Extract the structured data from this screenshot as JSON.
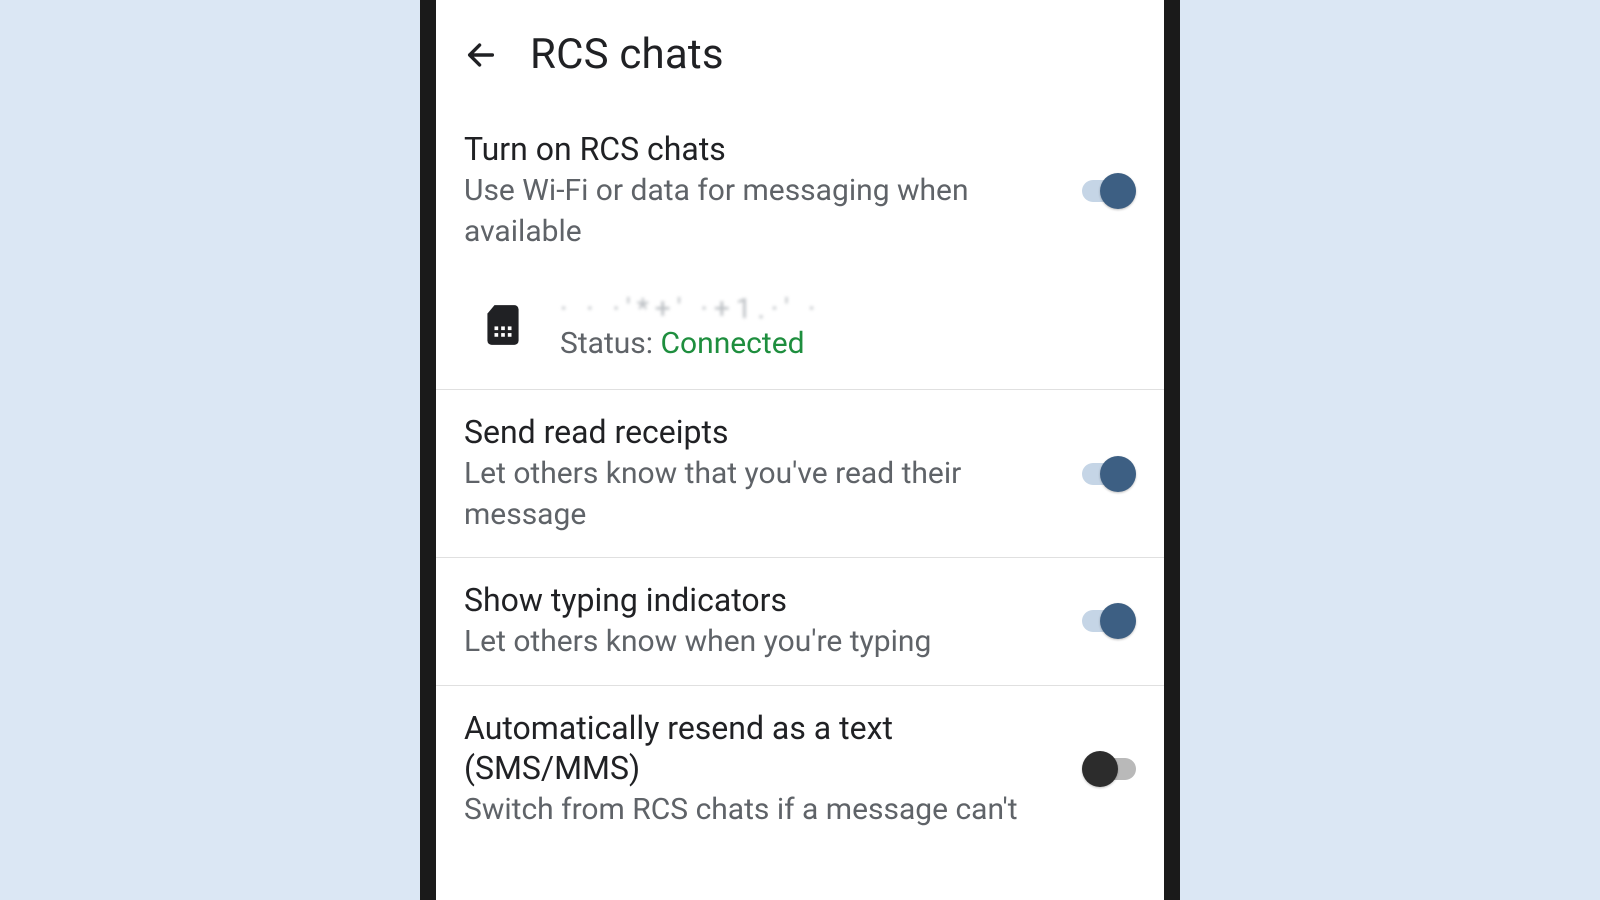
{
  "header": {
    "title": "RCS chats"
  },
  "settings": {
    "turn_on": {
      "title": "Turn on RCS chats",
      "subtitle": "Use Wi-Fi or data for messaging when available",
      "enabled": true
    },
    "sim": {
      "number_masked": "· · ·'*+' ·+1.·' ·",
      "status_label": "Status:",
      "status_value": "Connected"
    },
    "read_receipts": {
      "title": "Send read receipts",
      "subtitle": "Let others know that you've read their message",
      "enabled": true
    },
    "typing": {
      "title": "Show typing indicators",
      "subtitle": "Let others know when you're typing",
      "enabled": true
    },
    "auto_resend": {
      "title": "Automatically resend as a text (SMS/MMS)",
      "subtitle": "Switch from RCS chats if a message can't",
      "enabled": false
    }
  },
  "colors": {
    "accent": "#3d5f83",
    "status_connected": "#1e8e3e",
    "background_outer": "#dbe7f4"
  }
}
